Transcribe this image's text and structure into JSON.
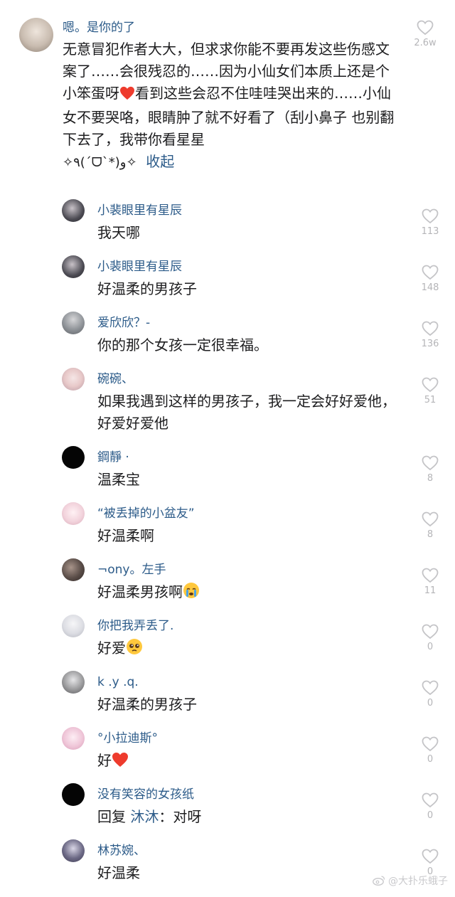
{
  "main_comment": {
    "username": "嗯。是你的了",
    "text": "无意冒犯作者大大，但求求你能不要再发这些伤感文案了……会很残忍的……因为小仙女们本质上还是个小笨蛋呀",
    "text_after_heart": "看到这些会忍不住哇哇哭出来的……小仙女不要哭咯，眼睛肿了就不好看了（刮小鼻子 也别翻下去了，我带你看星星",
    "sparkle_text": "✧٩(ˊᗜˋ*)و✧",
    "collapse_label": "收起",
    "likes": "2.6w"
  },
  "replies": [
    {
      "username": "小裴眼里有星辰",
      "text": "我天哪",
      "likes": "113",
      "avatar_color": "#4b4a52"
    },
    {
      "username": "小裴眼里有星辰",
      "text": "好温柔的男孩子",
      "likes": "148",
      "avatar_color": "#4b4a52"
    },
    {
      "username": "爱欣欣？-",
      "text": "你的那个女孩一定很幸福。",
      "likes": "136",
      "avatar_color": "#8f9398"
    },
    {
      "username": "碗碗、",
      "text": "如果我遇到这样的男孩子，我一定会好好爱他，好爱好爱他",
      "likes": "51",
      "avatar_color": "#e8c9c9"
    },
    {
      "username": "鋼靜 ·",
      "text": "温柔宝",
      "likes": "8",
      "avatar_color": "#050505"
    },
    {
      "username": "“被丢掉的小盆友”",
      "text": "好温柔啊",
      "likes": "8",
      "avatar_color": "#f2d3dc"
    },
    {
      "username": "¬ony。左手",
      "text": "好温柔男孩啊",
      "likes": "11",
      "avatar_color": "#5a4d48"
    },
    {
      "username": "你把我弄丢了.",
      "text": "好爱",
      "likes": "0",
      "avatar_color": "#dcdde3"
    },
    {
      "username": "k .y .q.",
      "text": "好温柔的男孩子",
      "likes": "0",
      "avatar_color": "#9a9a9c"
    },
    {
      "username": "°小拉迪斯°",
      "text": "好",
      "likes": "0",
      "avatar_color": "#efc6d8"
    },
    {
      "username": "没有笑容的女孩纸",
      "text_prefix": "回复",
      "reply_to": "沐沐",
      "text": "：对呀",
      "likes": "0",
      "avatar_color": "#050505"
    },
    {
      "username": "林苏婉、",
      "text": "好温柔",
      "likes": "0",
      "avatar_color": "#6d6a86"
    }
  ],
  "watermark": "@大扑乐蛾子",
  "icons": {
    "like": "heart-outline-icon",
    "emoji_heart": "red-heart-emoji",
    "emoji_cry": "crying-face-emoji",
    "emoji_pleading": "pleading-face-emoji",
    "weibo": "weibo-icon"
  }
}
